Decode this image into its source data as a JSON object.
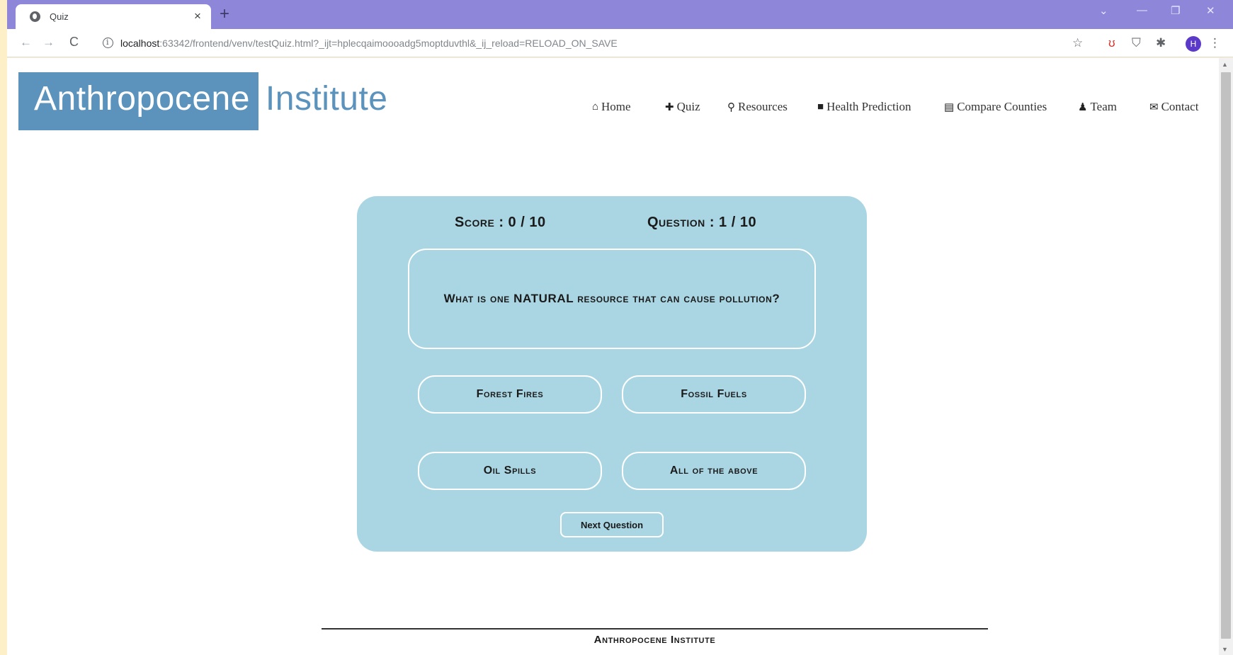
{
  "browser": {
    "tab_title": "Quiz",
    "tab_close": "×",
    "new_tab": "+",
    "url_host": "localhost",
    "url_rest": ":63342/frontend/venv/testQuiz.html?_ijt=hplecqaimoooadg5moptduvthl&_ij_reload=RELOAD_ON_SAVE",
    "profile_initial": "H",
    "controls": {
      "search_tabs": "⌄",
      "minimize": "—",
      "restore": "❐",
      "close": "✕"
    },
    "nav": {
      "back": "←",
      "forward": "→",
      "reload": "C"
    },
    "toolbar_icons": {
      "bookmark": "☆",
      "extension_red": "ʊ",
      "shield": "⛉",
      "puzzle": "✱",
      "menu": "⋮"
    }
  },
  "site": {
    "logo_box": "Anthropocene",
    "logo_rest": "Institute",
    "nav": [
      {
        "icon": "⌂",
        "label": "Home"
      },
      {
        "icon": "✚",
        "label": "Quiz"
      },
      {
        "icon": "⚲",
        "label": "Resources"
      },
      {
        "icon": "■",
        "label": "Health Prediction"
      },
      {
        "icon": "▤",
        "label": "Compare Counties"
      },
      {
        "icon": "♟",
        "label": "Team"
      },
      {
        "icon": "✉",
        "label": "Contact"
      }
    ]
  },
  "quiz": {
    "score_label": "Score : 0 / 10",
    "question_label": "Question : 1 / 10",
    "question": "What is one NATURAL resource that can cause pollution?",
    "choices": [
      "Forest Fires",
      "Fossil Fuels",
      "Oil Spills",
      "All of the above"
    ],
    "next_label": "Next Question"
  },
  "footer": {
    "title": "Anthropocene Institute"
  }
}
